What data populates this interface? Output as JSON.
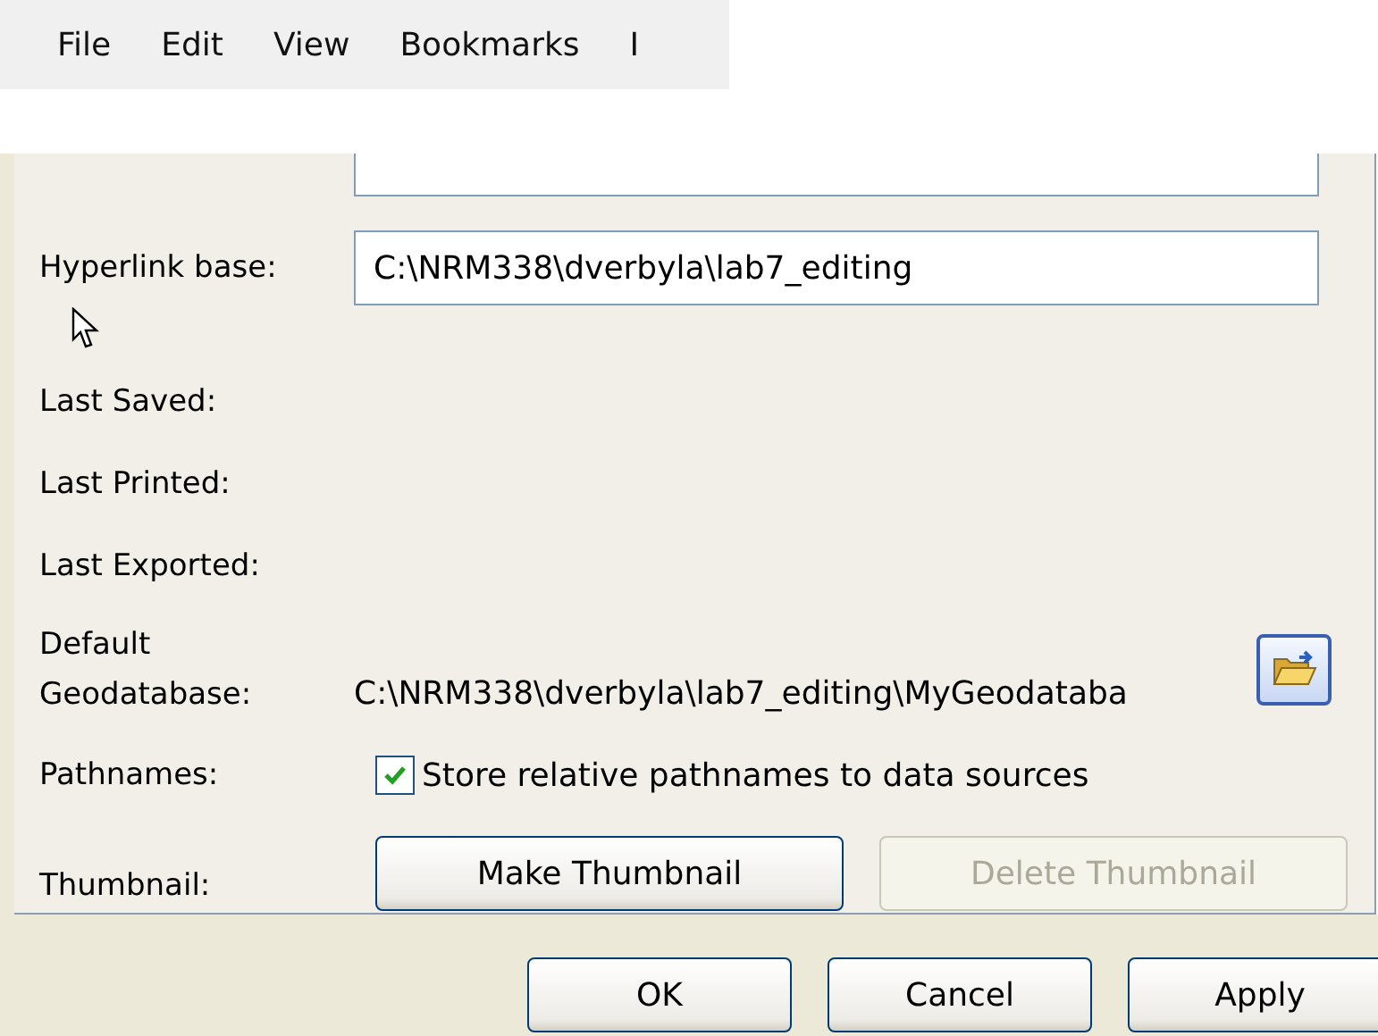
{
  "menu_bar": {
    "items": [
      "File",
      "Edit",
      "View",
      "Bookmarks",
      "I"
    ]
  },
  "properties": {
    "tags": {
      "kind": "field"
    },
    "hyperlink_base": {
      "label": "Hyperlink base:",
      "value": "C:\\NRM338\\dverbyla\\lab7_editing"
    },
    "info_rows": [
      {
        "label": "Last Saved:"
      },
      {
        "label": "Last Printed:"
      },
      {
        "label": "Last Exported:"
      }
    ],
    "default_geodatabase": {
      "label_line_1": "Default",
      "label_line_2": "Geodatabase:",
      "path": "C:\\NRM338\\dverbyla\\lab7_editing\\MyGeodataba"
    },
    "pathnames": {
      "label": "Pathnames:",
      "checkbox_label": "Store relative pathnames to data sources",
      "checked": true
    },
    "thumbnail": {
      "label": "Thumbnail:",
      "buttons": [
        {
          "label": "Make Thumbnail",
          "disabled": false
        },
        {
          "label": "Delete Thumbnail",
          "disabled": true
        }
      ]
    }
  },
  "dialog_buttons": [
    "OK",
    "Cancel",
    "Apply"
  ]
}
